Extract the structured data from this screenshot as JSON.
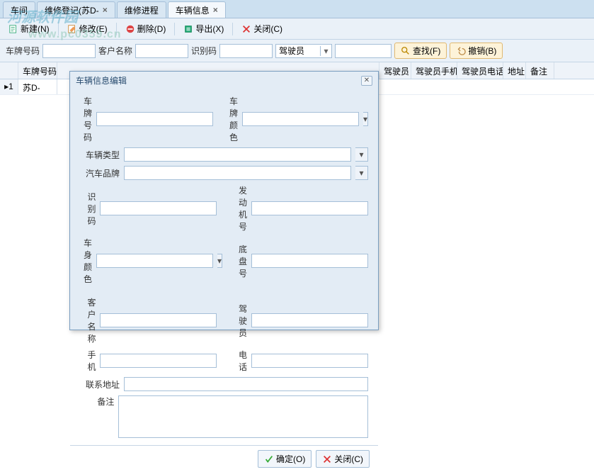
{
  "watermark": {
    "line1": "河源软件园",
    "line2": "www.pc0359.cn"
  },
  "tabs": [
    {
      "label": "车间",
      "closable": false
    },
    {
      "label": "维修登记(苏D-",
      "closable": true
    },
    {
      "label": "维修进程",
      "closable": false
    },
    {
      "label": "车辆信息",
      "closable": true,
      "active": true
    }
  ],
  "toolbar": {
    "new": "新建(N)",
    "edit": "修改(E)",
    "delete": "删除(D)",
    "export": "导出(X)",
    "close": "关闭(C)"
  },
  "search": {
    "plate_lbl": "车牌号码",
    "plate_val": "",
    "cust_lbl": "客户名称",
    "cust_val": "",
    "vin_lbl": "识别码",
    "vin_val": "",
    "driver_lbl": "驾驶员",
    "driver_val": "驾驶员",
    "extra_val": "",
    "find": "查找(F)",
    "undo": "撤销(B)"
  },
  "grid": {
    "columns": [
      "车牌号码",
      "",
      "",
      "",
      "",
      "",
      "",
      "",
      "驾驶员",
      "驾驶员手机",
      "驾驶员电话",
      "地址",
      "备注"
    ],
    "row1": {
      "idx": "1",
      "plate": "苏D-"
    }
  },
  "dialog": {
    "title": "车辆信息编辑",
    "labels": {
      "plate": "车牌号码",
      "plate_color": "车牌颜色",
      "vtype": "车辆类型",
      "brand": "汽车品牌",
      "vin": "识别码",
      "engine": "发动机号",
      "body_color": "车身颜色",
      "chassis": "底盘号",
      "cust": "客户名称",
      "driver": "驾驶员",
      "mobile": "手机",
      "phone": "电话",
      "addr": "联系地址",
      "remark": "备注"
    },
    "values": {
      "plate": "",
      "plate_color": "",
      "vtype": "",
      "brand": "",
      "vin": "",
      "engine": "",
      "body_color": "",
      "chassis": "",
      "cust": "",
      "driver": "",
      "mobile": "",
      "phone": "",
      "addr": "",
      "remark": ""
    },
    "ok": "确定(O)",
    "cancel": "关闭(C)"
  }
}
